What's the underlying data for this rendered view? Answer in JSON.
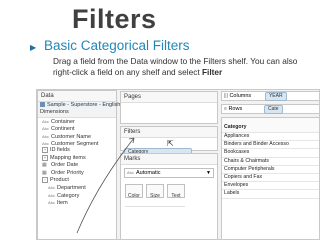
{
  "slide": {
    "title": "Filters",
    "heading": "Basic Categorical Filters",
    "body_before": "Drag a field from the Data window to the Filters shelf. You can also right-click a field on any shelf and select ",
    "body_bold": "Filter"
  },
  "data_pane": {
    "title": "Data",
    "datasource": "Sample - Superstore - English ...",
    "dimensions_label": "Dimensions",
    "fields": [
      {
        "type": "Abc",
        "name": "Container"
      },
      {
        "type": "Abc",
        "name": "Continent"
      },
      {
        "type": "Abc",
        "name": "Customer Name"
      },
      {
        "type": "Abc",
        "name": "Customer Segment"
      },
      {
        "type": "+",
        "name": "ID fields"
      },
      {
        "type": "+",
        "name": "Mapping items"
      },
      {
        "type": "",
        "name": "Order Date"
      },
      {
        "type": "",
        "name": "Order Priority"
      },
      {
        "type": "-",
        "name": "Product"
      },
      {
        "type": "Abc",
        "name": "Department"
      },
      {
        "type": "Abc",
        "name": "Category"
      },
      {
        "type": "Abc",
        "name": "Item"
      }
    ]
  },
  "pages_label": "Pages",
  "filters": {
    "label": "Filters",
    "pill": "Category"
  },
  "marks": {
    "label": "Marks",
    "type": "Automatic",
    "buttons": [
      "Color",
      "Size",
      "Text"
    ]
  },
  "shelves": {
    "columns_label": "Columns",
    "columns_pill": "YEAR",
    "rows_label": "Rows",
    "rows_pill": "Cate"
  },
  "category_list": {
    "header": "Category",
    "items": [
      "Appliances",
      "Binders and Binder Accesso",
      "Bookcases",
      "Chairs & Chairmats",
      "Computer Peripherals",
      "Copiers and Fax",
      "Envelopes",
      "Labels"
    ]
  }
}
